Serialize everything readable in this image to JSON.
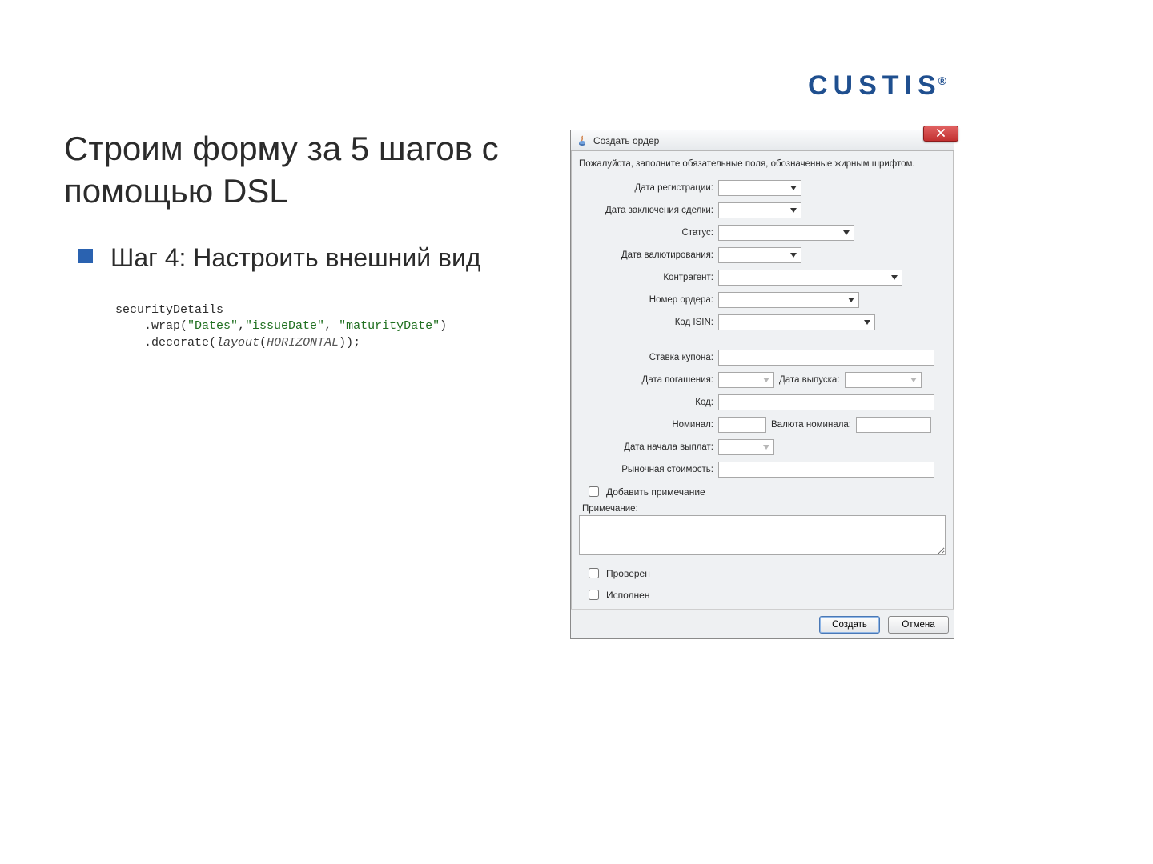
{
  "brand": {
    "name": "CUSTIS",
    "reg": "®"
  },
  "slide": {
    "title": "Строим форму за 5 шагов с помощью DSL",
    "bullet": "Шаг 4: Настроить внешний вид",
    "code": {
      "l1": "securityDetails",
      "l2a": "    .wrap(",
      "l2s1": "\"Dates\"",
      "l2c1": ",",
      "l2s2": "\"issueDate\"",
      "l2c2": ", ",
      "l2s3": "\"maturityDate\"",
      "l2b": ")",
      "l3a": "    .decorate(",
      "l3id": "layout",
      "l3p": "(",
      "l3cn": "HORIZONTAL",
      "l3b": "));"
    }
  },
  "win": {
    "title": "Создать ордер",
    "instruction": "Пожалуйста, заполните обязательные поля, обозначенные жирным шрифтом.",
    "labels": {
      "reg_date": "Дата регистрации:",
      "deal_date": "Дата заключения сделки:",
      "status": "Статус:",
      "value_date": "Дата валютирования:",
      "counterparty": "Контрагент:",
      "order_no": "Номер ордера:",
      "isin": "Код ISIN:",
      "coupon_rate": "Ставка купона:",
      "maturity_date": "Дата погашения:",
      "issue_date": "Дата выпуска:",
      "code": "Код:",
      "nominal": "Номинал:",
      "nominal_ccy": "Валюта номинала:",
      "pay_start_date": "Дата начала выплат:",
      "market_value": "Рыночная стоимость:",
      "add_note_cb": "Добавить примечание",
      "note": "Примечание:",
      "verified_cb": "Проверен",
      "executed_cb": "Исполнен"
    },
    "buttons": {
      "create": "Создать",
      "cancel": "Отмена"
    },
    "values": {
      "reg_date": "",
      "deal_date": "",
      "status": "",
      "value_date": "",
      "counterparty": "",
      "order_no": "",
      "isin": "",
      "coupon_rate": "",
      "maturity_date": "",
      "issue_date": "",
      "code": "",
      "nominal": "",
      "nominal_ccy": "",
      "pay_start_date": "",
      "market_value": "",
      "note": ""
    },
    "icons": {
      "close": "x",
      "java": "java-cup-icon"
    }
  },
  "colors": {
    "accent": "#2a62b0",
    "brand": "#1f4f8f",
    "close_btn": "#c23030"
  }
}
